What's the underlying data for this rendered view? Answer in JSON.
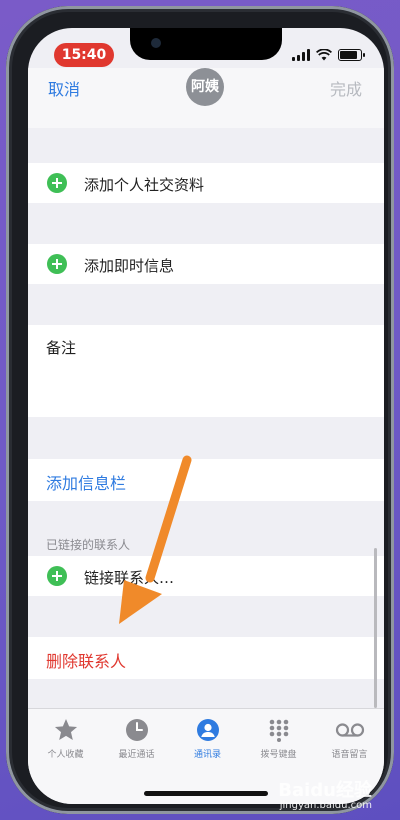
{
  "status_bar": {
    "time": "15:40"
  },
  "nav": {
    "cancel_label": "取消",
    "avatar_text": "阿姨",
    "done_label": "完成"
  },
  "rows": {
    "add_social_profile": "添加个人社交资料",
    "add_instant_message": "添加即时信息",
    "notes_label": "备注",
    "add_field": "添加信息栏",
    "linked_contacts_header": "已链接的联系人",
    "link_contacts": "链接联系人…",
    "delete_contact": "删除联系人"
  },
  "tabbar": {
    "items": [
      {
        "label": "个人收藏",
        "icon": "star-icon"
      },
      {
        "label": "最近通话",
        "icon": "clock-icon"
      },
      {
        "label": "通讯录",
        "icon": "person-icon",
        "active": true
      },
      {
        "label": "拨号键盘",
        "icon": "keypad-icon"
      },
      {
        "label": "语音留言",
        "icon": "voicemail-icon"
      }
    ]
  },
  "colors": {
    "accent": "#2f7be0",
    "destructive": "#e0382f",
    "add": "#3fbf56",
    "annotation_arrow": "#f08a2a"
  },
  "watermark": {
    "logo": "Baidu经验",
    "url": "jingyan.baidu.com"
  }
}
